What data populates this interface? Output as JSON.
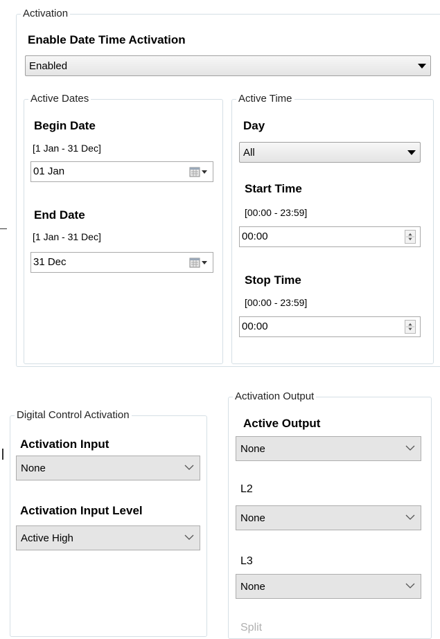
{
  "activation": {
    "legend": "Activation",
    "enable_label": "Enable Date Time Activation",
    "enable_value": "Enabled"
  },
  "active_dates": {
    "legend": "Active Dates",
    "begin_label": "Begin Date",
    "begin_range": "[1 Jan - 31 Dec]",
    "begin_value": "01 Jan",
    "end_label": "End Date",
    "end_range": "[1 Jan - 31 Dec]",
    "end_value": "31 Dec"
  },
  "active_time": {
    "legend": "Active Time",
    "day_label": "Day",
    "day_value": "All",
    "start_label": "Start Time",
    "start_range": "[00:00 - 23:59]",
    "start_value": "00:00",
    "stop_label": "Stop Time",
    "stop_range": "[00:00 - 23:59]",
    "stop_value": "00:00"
  },
  "digital_control": {
    "legend": "Digital Control Activation",
    "input_label": "Activation Input",
    "input_value": "None",
    "level_label": "Activation Input Level",
    "level_value": "Active High"
  },
  "activation_output": {
    "legend": "Activation Output",
    "output_label": "Active Output",
    "output_value": "None",
    "l2_label": "L2",
    "l2_value": "None",
    "l3_label": "L3",
    "l3_value": "None",
    "split_label": "Split"
  },
  "icons": {
    "calendar": "calendar-dropdown-icon",
    "spinner": "spinner-icon",
    "dropdown": "triangle-down-icon",
    "chevron": "chevron-down-icon"
  },
  "colors": {
    "group_border": "#d5dfe5",
    "combo_modern_bg": "#e5e5e5"
  }
}
